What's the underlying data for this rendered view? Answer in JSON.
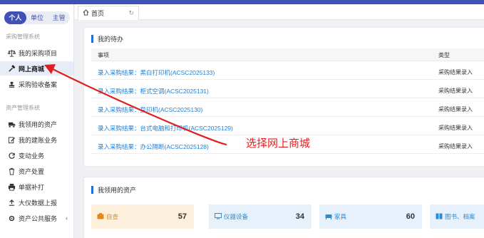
{
  "sidebar": {
    "roles": [
      "个人",
      "单位",
      "主管"
    ],
    "sections": [
      {
        "title": "采购管理系统",
        "items": [
          {
            "label": "我的采购项目",
            "icon": "scale-icon"
          },
          {
            "label": "网上商城",
            "icon": "hammer-icon",
            "active": true
          },
          {
            "label": "采购验收备案",
            "icon": "stamp-icon"
          }
        ]
      },
      {
        "title": "资产管理系统",
        "items": [
          {
            "label": "我领用的资产",
            "icon": "truck-icon"
          },
          {
            "label": "我的建账业务",
            "icon": "edit-icon"
          },
          {
            "label": "变动业务",
            "icon": "refresh-icon"
          },
          {
            "label": "资产处置",
            "icon": "trash-icon"
          },
          {
            "label": "单据补打",
            "icon": "printer-icon"
          },
          {
            "label": "大仪数据上报",
            "icon": "upload-icon"
          },
          {
            "label": "资产公共服务",
            "icon": "gear-icon"
          }
        ]
      }
    ]
  },
  "tabbar": {
    "home_label": "首页"
  },
  "todo": {
    "title": "我的待办",
    "headers": {
      "item": "事项",
      "type": "类型"
    },
    "rows": [
      {
        "item": "录入采购结果：黑白打印机(ACSC2025133)",
        "type": "采购结果录入"
      },
      {
        "item": "录入采购结果：柜式空调(ACSC2025131)",
        "type": "采购结果录入"
      },
      {
        "item": "录入采购结果：复印机(ACSC2025130)",
        "type": "采购结果录入"
      },
      {
        "item": "录入采购结果：台式电脑和打印机(ACSC2025129)",
        "type": "采购结果录入"
      },
      {
        "item": "录入采购结果：办公隔断(ACSC2025128)",
        "type": "采购结果录入"
      }
    ]
  },
  "assets": {
    "title": "我领用的资产",
    "cards": [
      {
        "label": "自查",
        "value": "57",
        "bg": "#fdf1dd",
        "color": "#e38a12",
        "icon": "self-check-icon"
      },
      {
        "label": "仪器设备",
        "value": "34",
        "bg": "#e6f1fb",
        "color": "#2a8bd6",
        "icon": "monitor-icon"
      },
      {
        "label": "家具",
        "value": "60",
        "bg": "#e6f1fb",
        "color": "#2a8bd6",
        "icon": "furniture-icon"
      },
      {
        "label": "图书、档案",
        "value": "",
        "bg": "#e6f1fb",
        "color": "#2a8bd6",
        "icon": "book-icon"
      }
    ]
  },
  "annotation": {
    "text": "选择网上商城",
    "color": "#e02020"
  },
  "colors": {
    "accent": "#3f51b5",
    "link": "#1e7fd6"
  }
}
